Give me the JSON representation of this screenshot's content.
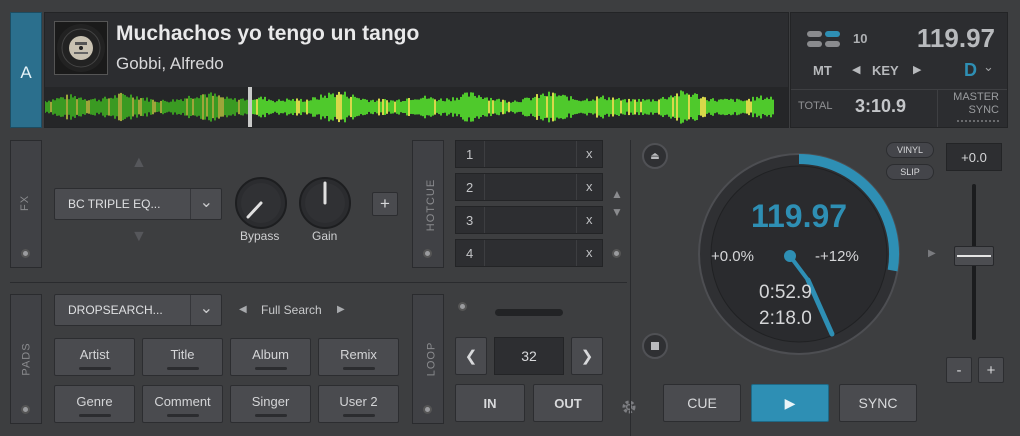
{
  "deck": {
    "letter": "A",
    "title": "Muchachos yo tengo un tango",
    "artist": "Gobbi, Alfredo",
    "bpm": "119.97",
    "key_counter": "10",
    "mt_label": "MT",
    "key_label": "KEY",
    "key_value": "D",
    "total_label": "TOTAL",
    "total_time": "3:10.9",
    "master_label": "MASTER",
    "sync_small_label": "SYNC",
    "accent_color": "#2e8fb4"
  },
  "fx": {
    "side_label": "FX",
    "effect_name": "BC TRIPLE EQ...",
    "knobs": [
      "Bypass",
      "Gain"
    ],
    "add_label": "+"
  },
  "hotcue": {
    "side_label": "HOTCUE",
    "slots": [
      {
        "num": "1",
        "clear": "x"
      },
      {
        "num": "2",
        "clear": "x"
      },
      {
        "num": "3",
        "clear": "x"
      },
      {
        "num": "4",
        "clear": "x"
      }
    ]
  },
  "pads": {
    "side_label": "PADS",
    "dropdown": "DROPSEARCH...",
    "search_mode": "Full Search",
    "buttons": [
      "Artist",
      "Title",
      "Album",
      "Remix",
      "Genre",
      "Comment",
      "Singer",
      "User 2"
    ]
  },
  "loop": {
    "side_label": "LOOP",
    "size": "32",
    "in_label": "IN",
    "out_label": "OUT"
  },
  "jog": {
    "bpm": "119.97",
    "pitch": "+0.0%",
    "range": "-+12%",
    "elapsed": "0:52.9",
    "remain": "2:18.0",
    "vinyl_label": "VINYL",
    "slip_label": "SLIP"
  },
  "transport": {
    "cue_label": "CUE",
    "play_label": "▶",
    "sync_label": "SYNC"
  },
  "pitch": {
    "value": "+0.0",
    "minus": "-",
    "plus": "+"
  }
}
